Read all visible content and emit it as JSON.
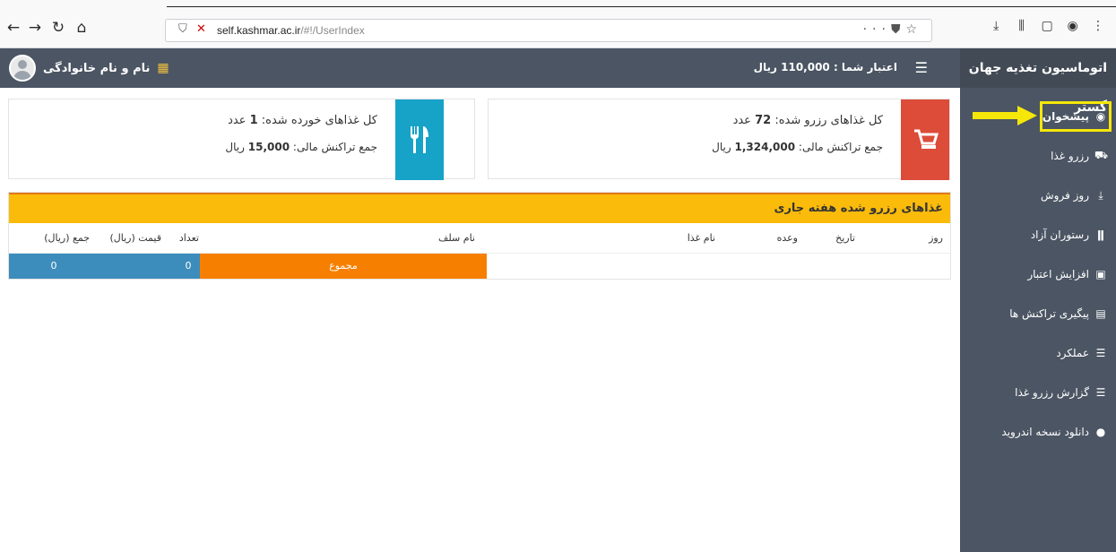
{
  "browser": {
    "url_domain": "self.kashmar.ac.ir",
    "url_path": "/#!/UserIndex",
    "back_icon": "back-arrow-icon",
    "forward_icon": "forward-arrow-icon",
    "reload_icon": "reload-icon",
    "home_icon": "home-icon",
    "more": "···"
  },
  "topbar": {
    "user_name": "نام و نام خانوادگی",
    "credit": "اعتبار شما : 110,000 ریال"
  },
  "sidebar": {
    "brand": "اتوماسیون تغذیه جهان گستر",
    "items": [
      {
        "label": "پیشخوان",
        "icon": "dashboard-icon",
        "glyph": "◉"
      },
      {
        "label": "رزرو غذا",
        "icon": "cart-icon",
        "glyph": "⛟"
      },
      {
        "label": "روز فروش",
        "icon": "download-icon",
        "glyph": "⤓"
      },
      {
        "label": "رستوران آزاد",
        "icon": "cutlery-icon",
        "glyph": "ǁ"
      },
      {
        "label": "افزایش اعتبار",
        "icon": "money-icon",
        "glyph": "▣"
      },
      {
        "label": "پیگیری تراکنش ها",
        "icon": "file-icon",
        "glyph": "▤"
      },
      {
        "label": "عملکرد",
        "icon": "list-icon",
        "glyph": "☰"
      },
      {
        "label": "گزارش رزرو غذا",
        "icon": "report-icon",
        "glyph": "☰"
      },
      {
        "label": "دانلود نسخه اندروید",
        "icon": "android-icon",
        "glyph": "●"
      }
    ]
  },
  "cards": {
    "reserved": {
      "line1_label": "کل غذاهای رزرو شده:",
      "line1_value": "72",
      "line1_unit": "عدد",
      "line2_label": "جمع تراکنش مالی:",
      "line2_value": "1,324,000",
      "line2_unit": "ریال",
      "color": "#dd4b39"
    },
    "eaten": {
      "line1_label": "کل غذاهای خورده شده:",
      "line1_value": "1",
      "line1_unit": "عدد",
      "line2_label": "جمع تراکنش مالی:",
      "line2_value": "15,000",
      "line2_unit": "ریال",
      "color": "#17a2c8"
    }
  },
  "panel": {
    "title": "غذاهای رزرو شده هفته جاری",
    "columns": [
      "روز",
      "تاریخ",
      "وعده",
      "نام غذا",
      "نام سلف",
      "تعداد",
      "قیمت (ریال)",
      "جمع (ریال)"
    ],
    "total_label": "مجموع",
    "total_count": "0",
    "total_sum": "0"
  }
}
